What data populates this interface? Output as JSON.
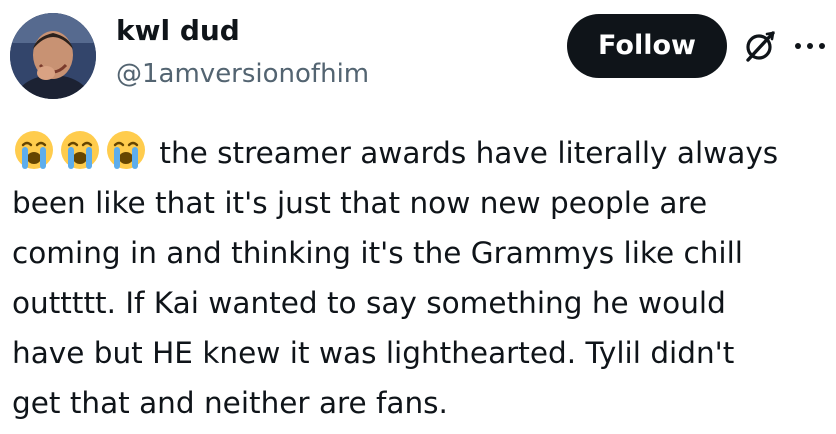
{
  "author": {
    "display_name": "kwl dud",
    "handle": "@1amversionofhim",
    "avatar_icon": "avatar-laughing-man"
  },
  "actions": {
    "follow_label": "Follow",
    "grok_icon": "grok-icon",
    "more_icon": "more-icon"
  },
  "tweet": {
    "emojis": [
      "loudly-crying-face",
      "loudly-crying-face",
      "loudly-crying-face"
    ],
    "lines": [
      " the streamer awards have literally always",
      "been like that it's just that now new people are",
      "coming in and thinking it's the Grammys like chill",
      "outtttt. If Kai wanted to say something he would",
      "have but HE knew it was lighthearted. Tylil didn't",
      "get that and neither are fans."
    ]
  },
  "colors": {
    "text": "#0f1419",
    "secondary": "#536471",
    "follow_bg": "#0f1419",
    "follow_text": "#ffffff",
    "emoji_face": "#ffcc4d",
    "emoji_tears": "#5dadec"
  }
}
